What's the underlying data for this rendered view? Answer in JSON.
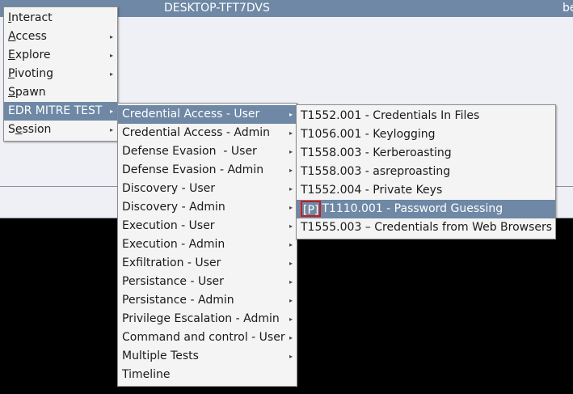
{
  "window": {
    "title": "DESKTOP-TFT7DVS",
    "right_text": "be"
  },
  "menu1": {
    "items": [
      {
        "label": "Interact",
        "mnemonic_index": 0,
        "submenu": false
      },
      {
        "label": "Access",
        "mnemonic_index": 0,
        "submenu": true
      },
      {
        "label": "Explore",
        "mnemonic_index": 0,
        "submenu": true
      },
      {
        "label": "Pivoting",
        "mnemonic_index": 0,
        "submenu": true
      },
      {
        "label": "Spawn",
        "mnemonic_index": 0,
        "submenu": false
      },
      {
        "label": "EDR MITRE TEST",
        "submenu": true,
        "selected": true
      },
      {
        "label": "Session",
        "mnemonic_index": 1,
        "submenu": true
      }
    ]
  },
  "menu2": {
    "items": [
      {
        "label": "Credential Access - User",
        "submenu": true,
        "selected": true
      },
      {
        "label": "Credential Access - Admin",
        "submenu": true
      },
      {
        "label": "Defense Evasion  - User",
        "submenu": true
      },
      {
        "label": "Defense Evasion - Admin",
        "submenu": true
      },
      {
        "label": "Discovery - User",
        "submenu": true
      },
      {
        "label": "Discovery - Admin",
        "submenu": true
      },
      {
        "label": "Execution - User",
        "submenu": true
      },
      {
        "label": "Execution - Admin",
        "submenu": true
      },
      {
        "label": "Exfiltration - User",
        "submenu": true
      },
      {
        "label": "Persistance - User",
        "submenu": true
      },
      {
        "label": "Persistance - Admin",
        "submenu": true
      },
      {
        "label": "Privilege Escalation - Admin",
        "submenu": true
      },
      {
        "label": "Command and control - User",
        "submenu": true
      },
      {
        "label": "Multiple Tests",
        "submenu": true
      },
      {
        "label": "Timeline",
        "submenu": false
      }
    ]
  },
  "menu3": {
    "items": [
      {
        "label": "T1552.001 - Credentials In Files"
      },
      {
        "label": "T1056.001 - Keylogging"
      },
      {
        "label": "T1558.003 - Kerberoasting"
      },
      {
        "label": "T1558.003 - asreproasting"
      },
      {
        "label": "T1552.004 - Private Keys"
      },
      {
        "tag": "[P]",
        "label": "T1110.001 - Password Guessing",
        "selected": true
      },
      {
        "label": "T1555.003 – Credentials from Web Browsers"
      }
    ]
  }
}
